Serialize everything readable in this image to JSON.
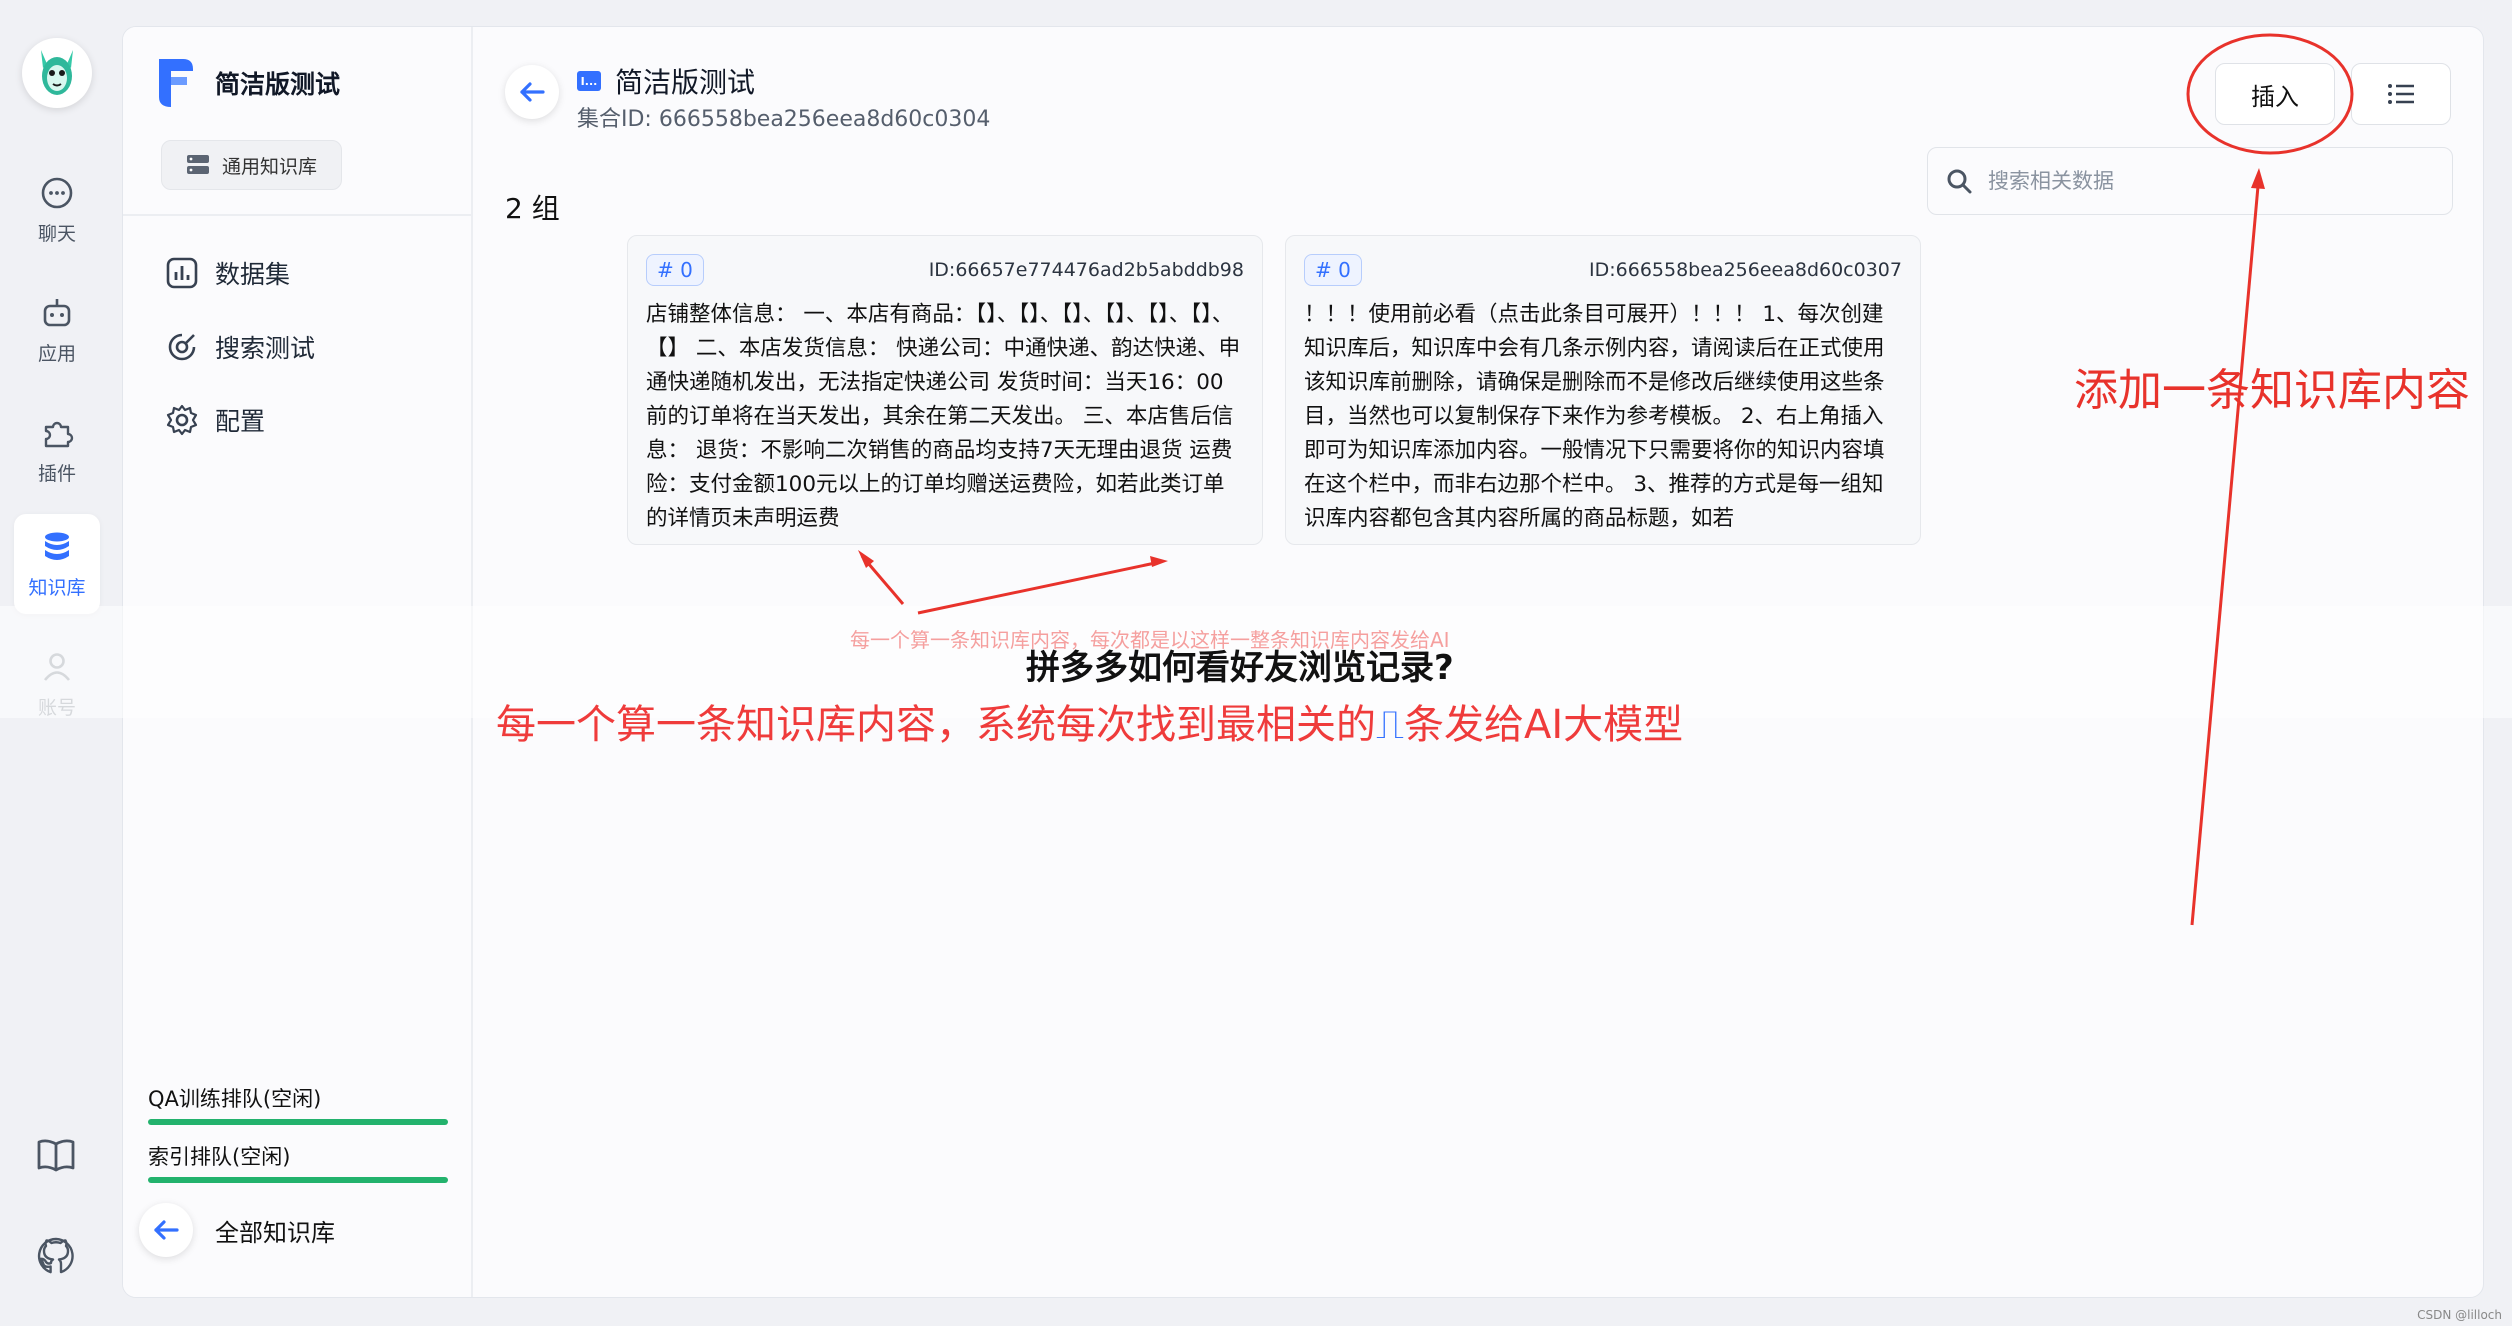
{
  "nav": {
    "items": [
      {
        "label": "聊天",
        "icon": "chat-icon"
      },
      {
        "label": "应用",
        "icon": "robot-icon"
      },
      {
        "label": "插件",
        "icon": "puzzle-icon"
      },
      {
        "label": "知识库",
        "icon": "database-icon",
        "active": true
      },
      {
        "label": "账号",
        "icon": "user-icon"
      }
    ],
    "bottom_icons": [
      "book-icon",
      "github-icon"
    ]
  },
  "sidebar": {
    "kb_name": "简洁版测试",
    "kb_type": "通用知识库",
    "menu": [
      {
        "label": "数据集",
        "icon": "chart-icon"
      },
      {
        "label": "搜索测试",
        "icon": "search-test-icon"
      },
      {
        "label": "配置",
        "icon": "gear-icon"
      }
    ],
    "queues": [
      {
        "label": "QA训练排队(空闲)"
      },
      {
        "label": "索引排队(空闲)"
      }
    ],
    "all_kb": "全部知识库"
  },
  "header": {
    "collection_name": "简洁版测试",
    "collection_id": "集合ID: 666558bea256eea8d60c0304",
    "insert_label": "插入",
    "group_count": "2 组",
    "search_placeholder": "搜索相关数据"
  },
  "cards": [
    {
      "index": "# 0",
      "id": "ID:66657e774476ad2b5abddb98",
      "text": "店铺整体信息： 一、本店有商品：【】、【】、【】、【】、【】、【】、【】 二、本店发货信息： 快递公司：中通快递、韵达快递、申通快递随机发出，无法指定快递公司 发货时间：当天16：00前的订单将在当天发出，其余在第二天发出。 三、本店售后信息： 退货：不影响二次销售的商品均支持7天无理由退货 运费险：支付金额100元以上的订单均赠送运费险，如若此类订单的详情页未声明运费"
    },
    {
      "index": "# 0",
      "id": "ID:666558bea256eea8d60c0307",
      "text": "！！！使用前必看（点击此条目可展开）！！！ 1、每次创建知识库后，知识库中会有几条示例内容，请阅读后在正式使用该知识库前删除，请确保是删除而不是修改后继续使用这些条目，当然也可以复制保存下来作为参考模板。 2、右上角插入即可为知识库添加内容。一般情况下只需要将你的知识内容填在这个栏中，而非右边那个栏中。 3、推荐的方式是每一组知识库内容都包含其内容所属的商品标题，如若"
    }
  ],
  "annotations": {
    "faint": "每一个算一条知识库内容，每次都是以这样一整条知识库内容发给AI",
    "title": "拼多多如何看好友浏览记录?",
    "note_before": "每一个算一条知识库内容，系统每次找到最相关的",
    "note_glyph": "⎍",
    "note_after": "条发给AI大模型",
    "right": "添加一条知识库内容",
    "watermark": "CSDN @lilloch"
  },
  "colors": {
    "accent": "#3370ff",
    "annotation_red": "#e8322b",
    "queue_bar": "#23b26d"
  }
}
